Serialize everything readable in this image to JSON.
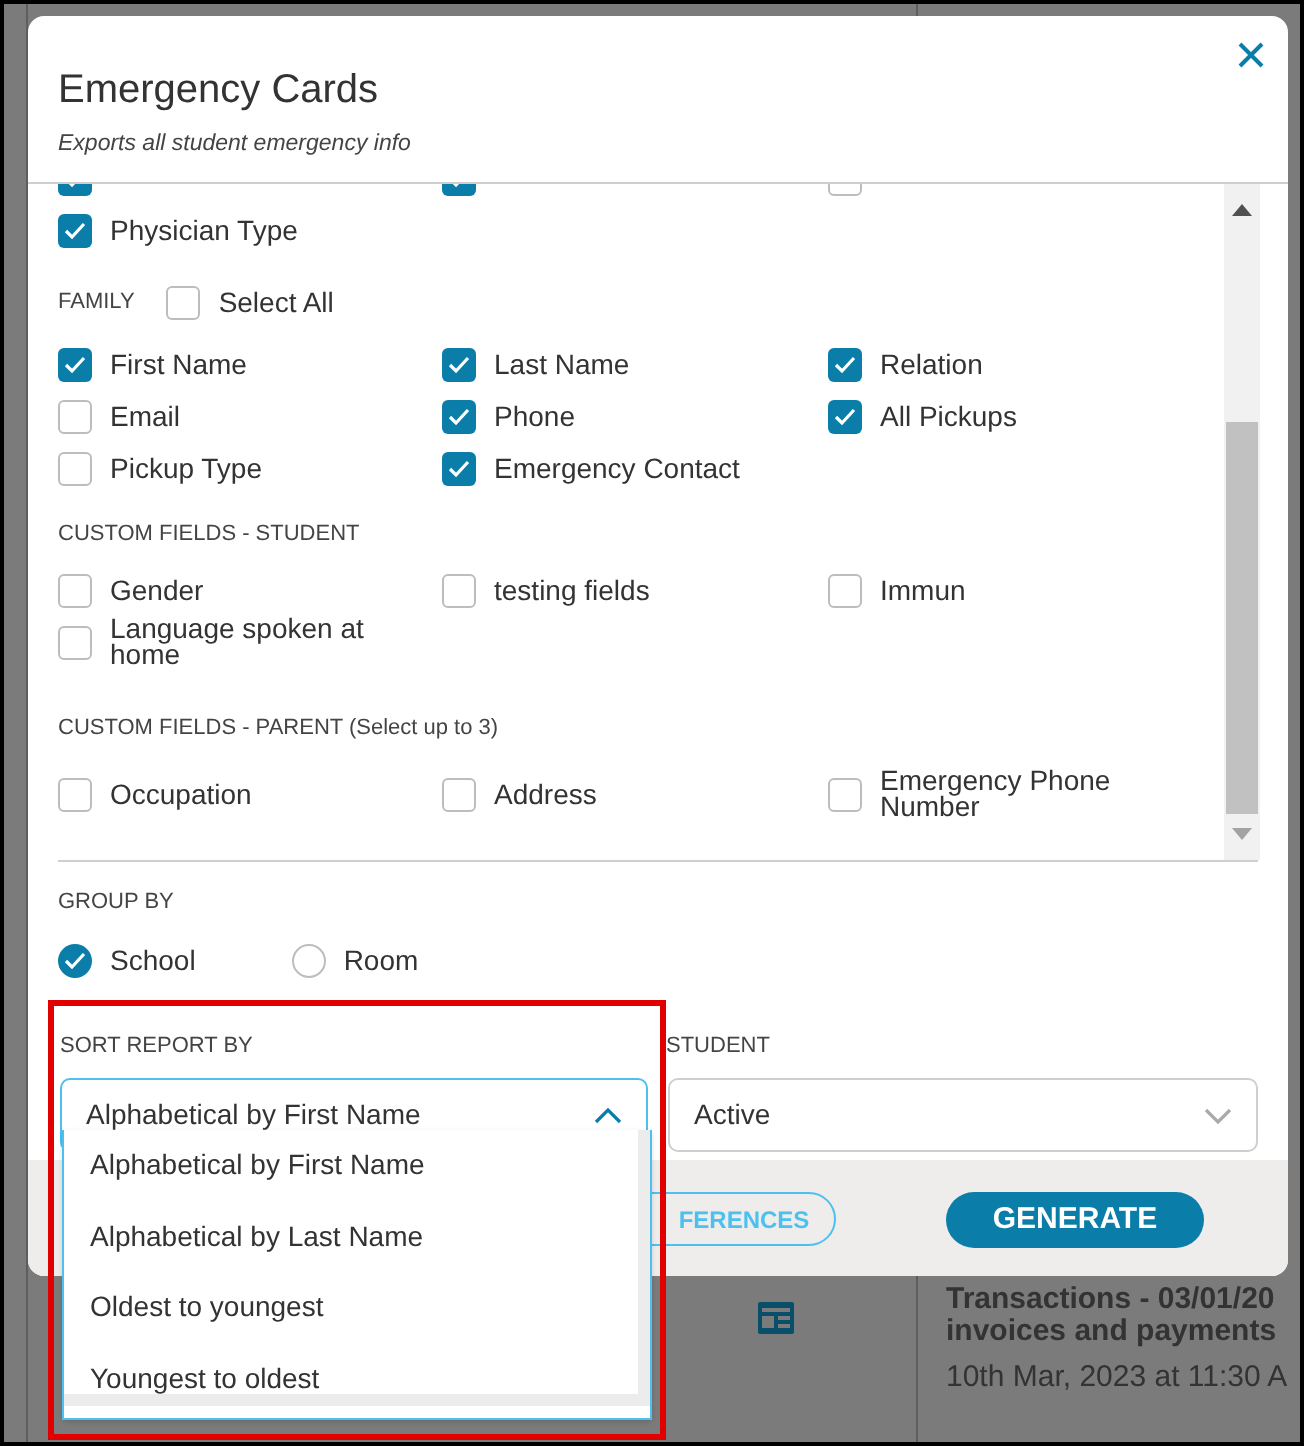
{
  "background": {
    "entries": [
      {
        "title": "Transactions - 03/01/20",
        "subtitle": "invoices and payments",
        "date": "10th Mar, 2023 at 11:30 A"
      }
    ]
  },
  "dialog": {
    "title": "Emergency Cards",
    "subtitle": "Exports all student emergency info"
  },
  "sections": [
    {
      "fields": [
        {
          "checked": true
        },
        {
          "checked": true
        },
        {
          "checked": false
        },
        {
          "label": "Physician Type",
          "checked": true
        }
      ]
    },
    {
      "heading": "FAMILY",
      "select_all": {
        "label": "Select All",
        "checked": false
      },
      "fields": [
        {
          "label": "First Name",
          "checked": true
        },
        {
          "label": "Last Name",
          "checked": true
        },
        {
          "label": "Relation",
          "checked": true
        },
        {
          "label": "Email",
          "checked": false
        },
        {
          "label": "Phone",
          "checked": true
        },
        {
          "label": "All Pickups",
          "checked": true
        },
        {
          "label": "Pickup Type",
          "checked": false
        },
        {
          "label": "Emergency Contact",
          "checked": true
        }
      ]
    },
    {
      "heading": "CUSTOM FIELDS - STUDENT",
      "fields": [
        {
          "label": "Gender",
          "checked": false
        },
        {
          "label": "testing fields",
          "checked": false
        },
        {
          "label": "Immun",
          "checked": false
        },
        {
          "label": "Language spoken at home",
          "checked": false
        }
      ]
    },
    {
      "heading": "CUSTOM FIELDS - PARENT (Select up to 3)",
      "fields": [
        {
          "label": "Occupation",
          "checked": false
        },
        {
          "label": "Address",
          "checked": false
        },
        {
          "label": "Emergency Phone Number",
          "checked": false
        }
      ]
    }
  ],
  "group_by": {
    "label": "GROUP BY",
    "options": [
      {
        "label": "School",
        "selected": true
      },
      {
        "label": "Room",
        "selected": false
      }
    ]
  },
  "sort": {
    "label": "SORT REPORT BY",
    "value": "Alphabetical by First Name",
    "expanded": true,
    "options": [
      {
        "label": "Alphabetical by First Name"
      },
      {
        "label": "Alphabetical by Last Name"
      },
      {
        "label": "Oldest to youngest"
      },
      {
        "label": "Youngest to oldest"
      }
    ]
  },
  "student": {
    "label": "STUDENT",
    "value": "Active",
    "expanded": false
  },
  "buttons": [
    {
      "label": "FERENCES",
      "kind": "outline"
    },
    {
      "label": "GENERATE",
      "kind": "primary"
    }
  ]
}
